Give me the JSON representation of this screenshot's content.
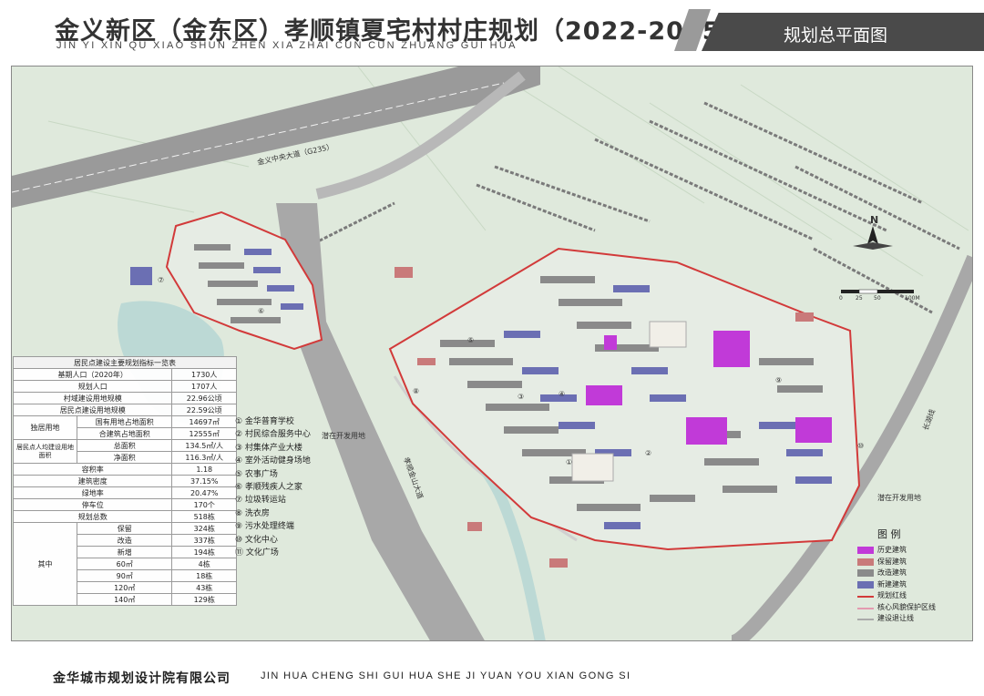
{
  "header": {
    "title": "金义新区（金东区）孝顺镇夏宅村村庄规划（2022-2035）",
    "pinyin": "JIN YI XIN QU XIAO SHUN ZHEN XIA ZHAI CUN CUN ZHUANG GUI HUA",
    "sheet_name": "规划总平面图"
  },
  "map": {
    "north_label": "N",
    "scale_labels": [
      "0",
      "25",
      "50",
      "100M"
    ],
    "road_label_1": "金义中央大道（G235）",
    "road_label_2": "长湖线",
    "road_label_3": "孝顺金山大道",
    "notes": [
      "潜在开发用地",
      "潜在开发用地"
    ],
    "poi_markers": [
      "①",
      "②",
      "③",
      "④",
      "⑤",
      "⑥",
      "⑦",
      "⑧",
      "⑨",
      "⑩"
    ],
    "colors": {
      "background": "#dfe9dc",
      "water": "#bcd9d5",
      "road": "#b8b8b8",
      "boundary": "#d23a3a",
      "historic": "#c13ad8",
      "traditional": "#c97a7a",
      "modern": "#8a8a8a",
      "new_build": "#6b6fb3"
    }
  },
  "stats": {
    "title": "居民点建设主要规划指标一览表",
    "rows": [
      [
        "基期人口（2020年）",
        "1730人"
      ],
      [
        "规划人口",
        "1707人"
      ],
      [
        "村域建设用地规模",
        "22.96公顷"
      ],
      [
        "居民点建设用地规模",
        "22.59公顷"
      ]
    ],
    "land_group_label": "独居用地",
    "land_rows": [
      [
        "国有用地占地面积",
        "14697㎡"
      ],
      [
        "合建筑占地面积",
        "12555㎡"
      ]
    ],
    "per_capita_group_label": "居民点人均建设用地面积",
    "per_capita_rows": [
      [
        "总面积",
        "134.5㎡/人"
      ],
      [
        "净面积",
        "116.3㎡/人"
      ]
    ],
    "rows2": [
      [
        "容积率",
        "1.18"
      ],
      [
        "建筑密度",
        "37.15%"
      ],
      [
        "绿地率",
        "20.47%"
      ],
      [
        "停车位",
        "170个"
      ],
      [
        "规划总数",
        "518栋"
      ]
    ],
    "group_label": "其中",
    "sub_label": "其中",
    "rows3": [
      [
        "保留",
        "324栋"
      ],
      [
        "改造",
        "337栋"
      ],
      [
        "新增",
        "194栋"
      ]
    ],
    "rows4": [
      [
        "60㎡",
        "4栋"
      ],
      [
        "90㎡",
        "18栋"
      ],
      [
        "120㎡",
        "43栋"
      ],
      [
        "140㎡",
        "129栋"
      ]
    ]
  },
  "poi_list": [
    "① 金华普育学校",
    "② 村民综合服务中心",
    "③ 村集体产业大楼",
    "④ 室外活动健身场地",
    "⑤ 农事广场",
    "⑥ 孝顺残疾人之家",
    "⑦ 垃圾转运站",
    "⑧ 洗衣房",
    "⑨ 污水处理终端",
    "⑩ 文化中心",
    "⑪ 文化广场"
  ],
  "legend": {
    "title": "图 例",
    "items": [
      {
        "label": "历史建筑",
        "color": "#c13ad8"
      },
      {
        "label": "保留建筑",
        "color": "#c97a7a"
      },
      {
        "label": "改造建筑",
        "color": "#8a8a8a"
      },
      {
        "label": "新建建筑",
        "color": "#6b6fb3"
      },
      {
        "label": "规划红线",
        "color": "#d23a3a"
      },
      {
        "label": "核心风貌保护区线",
        "color": "#e39ab0"
      },
      {
        "label": "建设退让线",
        "color": "#aaaaaa"
      }
    ]
  },
  "footer": {
    "company": "金华城市规划设计院有限公司",
    "pinyin": "JIN HUA CHENG SHI GUI HUA SHE JI YUAN YOU XIAN GONG SI"
  }
}
